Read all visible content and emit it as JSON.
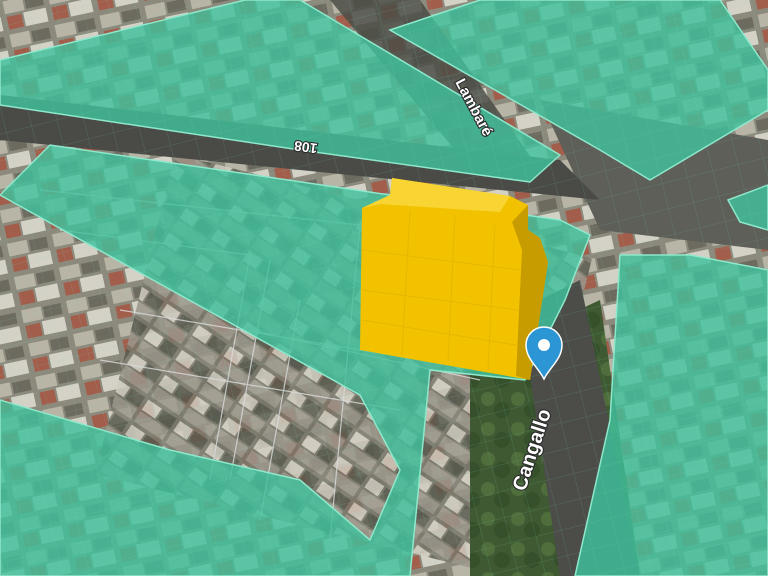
{
  "map": {
    "street_labels": [
      {
        "id": "cangallo",
        "text": "Cangallo"
      },
      {
        "id": "lambare",
        "text": "Lambaré"
      },
      {
        "id": "street-108",
        "text": "108"
      }
    ],
    "marker": {
      "icon": "location-pin-icon",
      "color": "#2c95d4"
    },
    "selected_building": {
      "color": "#f2c200"
    },
    "block_overlay": {
      "color": "#3fc19c"
    }
  }
}
